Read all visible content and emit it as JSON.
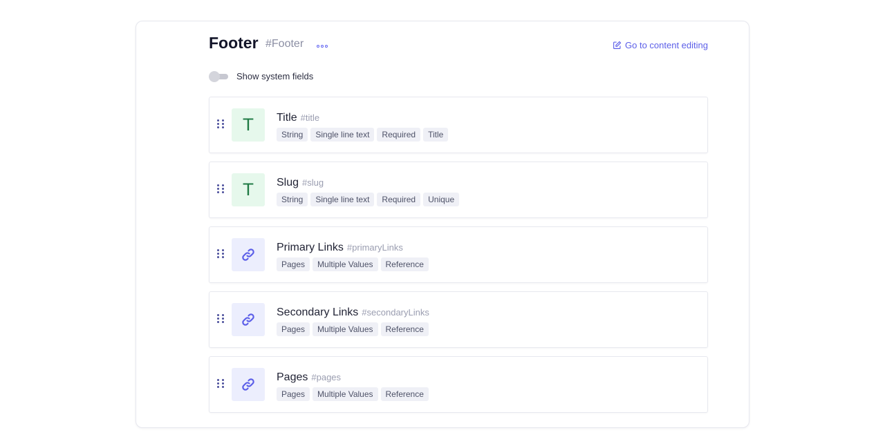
{
  "header": {
    "title": "Footer",
    "api_id": "#Footer",
    "more_icon": "more-horizontal-icon",
    "edit_link_label": "Go to content editing",
    "edit_link_icon": "edit-icon"
  },
  "system_fields_toggle": {
    "label": "Show system fields",
    "checked": false
  },
  "colors": {
    "accent": "#5b5ee8",
    "text_tile_bg": "#e6f8ec",
    "text_tile_fg": "#1f7a44",
    "ref_tile_bg": "#eceefd"
  },
  "fields": [
    {
      "name": "Title",
      "api_id": "#title",
      "type_icon": "T",
      "type": "text",
      "tags": [
        "String",
        "Single line text",
        "Required",
        "Title"
      ]
    },
    {
      "name": "Slug",
      "api_id": "#slug",
      "type_icon": "T",
      "type": "text",
      "tags": [
        "String",
        "Single line text",
        "Required",
        "Unique"
      ]
    },
    {
      "name": "Primary Links",
      "api_id": "#primaryLinks",
      "type_icon": "link-icon",
      "type": "reference",
      "tags": [
        "Pages",
        "Multiple Values",
        "Reference"
      ]
    },
    {
      "name": "Secondary Links",
      "api_id": "#secondaryLinks",
      "type_icon": "link-icon",
      "type": "reference",
      "tags": [
        "Pages",
        "Multiple Values",
        "Reference"
      ]
    },
    {
      "name": "Pages",
      "api_id": "#pages",
      "type_icon": "link-icon",
      "type": "reference",
      "tags": [
        "Pages",
        "Multiple Values",
        "Reference"
      ]
    }
  ]
}
